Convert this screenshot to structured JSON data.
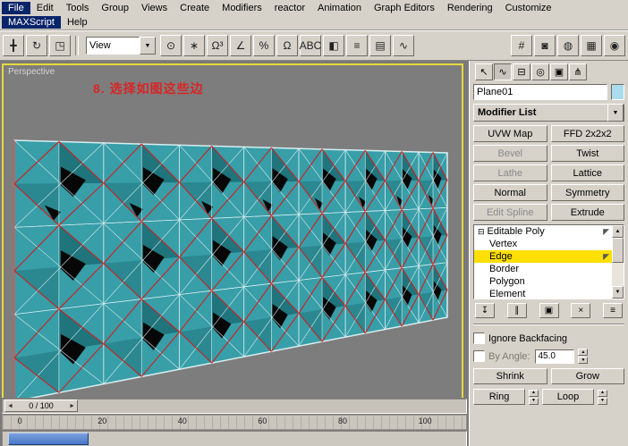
{
  "icons": {
    "chevron_down": "▼",
    "up": "▲",
    "down": "▼",
    "left": "◄",
    "right": "►",
    "cursor": "◤",
    "expand": "⊟"
  },
  "menubar": {
    "row1": [
      {
        "label": "File",
        "highlighted": true
      },
      {
        "label": "Edit"
      },
      {
        "label": "Tools"
      },
      {
        "label": "Group"
      },
      {
        "label": "Views"
      },
      {
        "label": "Create"
      },
      {
        "label": "Modifiers"
      },
      {
        "label": "reactor"
      },
      {
        "label": "Animation"
      },
      {
        "label": "Graph Editors"
      },
      {
        "label": "Rendering"
      },
      {
        "label": "Customize"
      }
    ],
    "row2": [
      {
        "label": "MAXScript",
        "highlighted": true
      },
      {
        "label": "Help"
      }
    ]
  },
  "toolbar": {
    "coordinate_system_label": "View",
    "left_icons": [
      {
        "name": "select-and-move-button",
        "glyph": "╋"
      },
      {
        "name": "select-and-rotate-button",
        "glyph": "↻"
      },
      {
        "name": "select-and-scale-button",
        "glyph": "◳"
      }
    ],
    "mid_icons": [
      {
        "name": "use-pivot-center-button",
        "glyph": "⊙"
      },
      {
        "name": "select-and-manipulate-button",
        "glyph": "∗"
      },
      {
        "name": "snap-toggle-3d-button",
        "glyph": "Ω³"
      },
      {
        "name": "angle-snap-button",
        "glyph": "∠"
      },
      {
        "name": "percent-snap-button",
        "glyph": "%"
      },
      {
        "name": "spinner-snap-button",
        "glyph": "Ω"
      },
      {
        "name": "named-selection-sets-button",
        "glyph": "ABC"
      },
      {
        "name": "mirror-button",
        "glyph": "◧"
      },
      {
        "name": "align-button",
        "glyph": "≡"
      },
      {
        "name": "layer-manager-button",
        "glyph": "▤"
      },
      {
        "name": "curve-editor-button",
        "glyph": "∿"
      }
    ],
    "right_icons": [
      {
        "name": "schematic-view-button",
        "glyph": "#"
      },
      {
        "name": "material-editor-button",
        "glyph": "◙"
      },
      {
        "name": "render-setup-button",
        "glyph": "◍"
      },
      {
        "name": "render-type-button",
        "glyph": "▦"
      },
      {
        "name": "quick-render-button",
        "glyph": "◉"
      }
    ]
  },
  "viewport": {
    "label": "Perspective",
    "annotation": "8. 选择如图这些边",
    "mesh_colors": {
      "base": "#389ea8",
      "shade": "#20747c",
      "shade2": "#2b8890",
      "wire": "#d8eef0",
      "selected": "#cc2020",
      "hole": "#070707"
    }
  },
  "command_panel": {
    "tabs": [
      {
        "name": "tab-create",
        "glyph": "↖"
      },
      {
        "name": "tab-modify",
        "glyph": "∿",
        "active": true
      },
      {
        "name": "tab-hierarchy",
        "glyph": "⊟"
      },
      {
        "name": "tab-motion",
        "glyph": "◎"
      },
      {
        "name": "tab-display",
        "glyph": "▣"
      },
      {
        "name": "tab-utilities",
        "glyph": "⋔"
      }
    ],
    "object_name": "Plane01",
    "modifier_list_label": "Modifier List",
    "modifier_buttons": [
      {
        "label": "UVW Map",
        "enabled": true
      },
      {
        "label": "FFD 2x2x2",
        "enabled": true
      },
      {
        "label": "Bevel",
        "enabled": false
      },
      {
        "label": "Twist",
        "enabled": true
      },
      {
        "label": "Lathe",
        "enabled": false
      },
      {
        "label": "Lattice",
        "enabled": true
      },
      {
        "label": "Normal",
        "enabled": true
      },
      {
        "label": "Symmetry",
        "enabled": true
      },
      {
        "label": "Edit Spline",
        "enabled": false
      },
      {
        "label": "Extrude",
        "enabled": true
      }
    ],
    "stack": {
      "root": "Editable Poly",
      "items": [
        {
          "label": "Vertex"
        },
        {
          "label": "Edge",
          "selected": true
        },
        {
          "label": "Border"
        },
        {
          "label": "Polygon"
        },
        {
          "label": "Element"
        }
      ]
    },
    "stack_tools": [
      {
        "name": "pin-stack-button",
        "glyph": "↧"
      },
      {
        "name": "show-end-result-button",
        "glyph": "∥"
      },
      {
        "name": "make-unique-button",
        "glyph": "▣"
      },
      {
        "name": "remove-modifier-button",
        "glyph": "×"
      },
      {
        "name": "configure-modifier-sets-button",
        "glyph": "≡"
      }
    ],
    "selection_rollout": {
      "ignore_backfacing": "Ignore Backfacing",
      "by_angle": "By Angle:",
      "angle_value": "45.0",
      "shrink": "Shrink",
      "grow": "Grow",
      "ring": "Ring",
      "loop": "Loop"
    }
  },
  "timeline": {
    "slider_label": "0 / 100",
    "ticks": [
      "0",
      "20",
      "40",
      "60",
      "80",
      "100"
    ]
  },
  "colors": {
    "menu_highlight": "#0a246a",
    "viewport_border": "#e8d840",
    "viewport_bg": "#7d7d7d",
    "annotation_color": "#d92525",
    "stack_selected_bg": "#ffdf00",
    "object_swatch": "#aadcee",
    "scrollbar_thumb": "#4878c8",
    "panel_bg": "#d6d2ca"
  }
}
